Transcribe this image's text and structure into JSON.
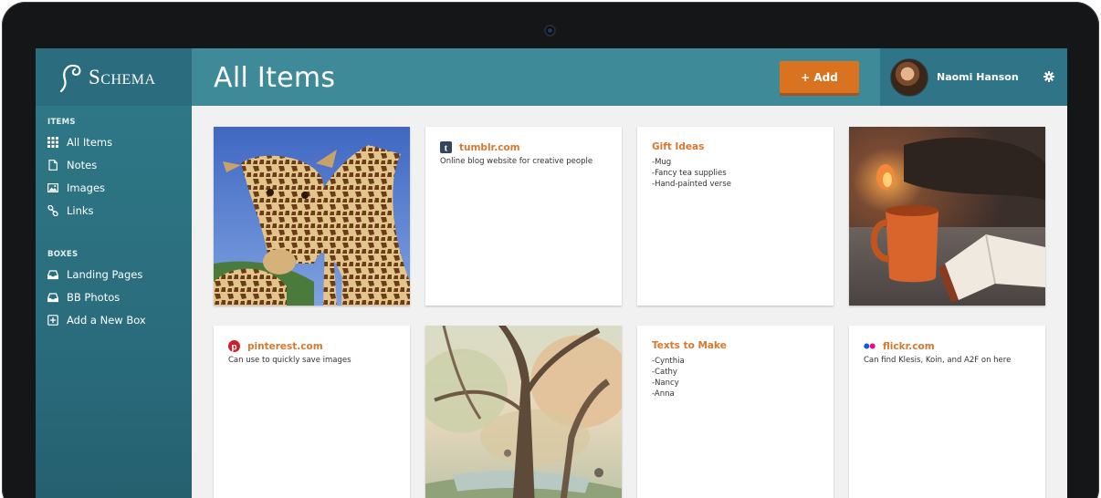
{
  "app": {
    "logo_text": "Schema",
    "page_title": "All Items",
    "add_button_label": "+ Add",
    "user_name": "Naomi Hanson"
  },
  "sidebar": {
    "items_heading": "ITEMS",
    "items": [
      {
        "label": "All Items",
        "icon": "grid-icon"
      },
      {
        "label": "Notes",
        "icon": "note-icon"
      },
      {
        "label": "Images",
        "icon": "image-icon"
      },
      {
        "label": "Links",
        "icon": "link-icon"
      }
    ],
    "boxes_heading": "BOXES",
    "boxes": [
      {
        "label": "Landing Pages",
        "icon": "inbox-icon"
      },
      {
        "label": "BB Photos",
        "icon": "inbox-icon"
      },
      {
        "label": "Add a New Box",
        "icon": "plus-square-icon"
      }
    ]
  },
  "cards": {
    "tumblr": {
      "title": "tumblr.com",
      "desc": "Online blog website for creative people",
      "icon": "tumblr-icon",
      "color": "#35465c"
    },
    "gift_ideas": {
      "title": "Gift Ideas",
      "lines": [
        "-Mug",
        "-Fancy tea supplies",
        "-Hand-painted verse"
      ]
    },
    "pinterest": {
      "title": "pinterest.com",
      "desc": "Can use to quickly save images",
      "icon": "pinterest-icon",
      "color": "#cb2027"
    },
    "texts_to_make": {
      "title": "Texts to Make",
      "lines": [
        "-Cynthia",
        "-Cathy",
        "-Nancy",
        "-Anna"
      ]
    },
    "flickr": {
      "title": "flickr.com",
      "desc": "Can find Klesis, Koin, and A2F on here",
      "icon": "flickr-icon"
    }
  },
  "colors": {
    "topbar": "#3f8a99",
    "logo_bg": "#2b6d7e",
    "sidebar": "#2a6c7c",
    "accent_orange": "#d97320",
    "card_title": "#d9782d"
  }
}
